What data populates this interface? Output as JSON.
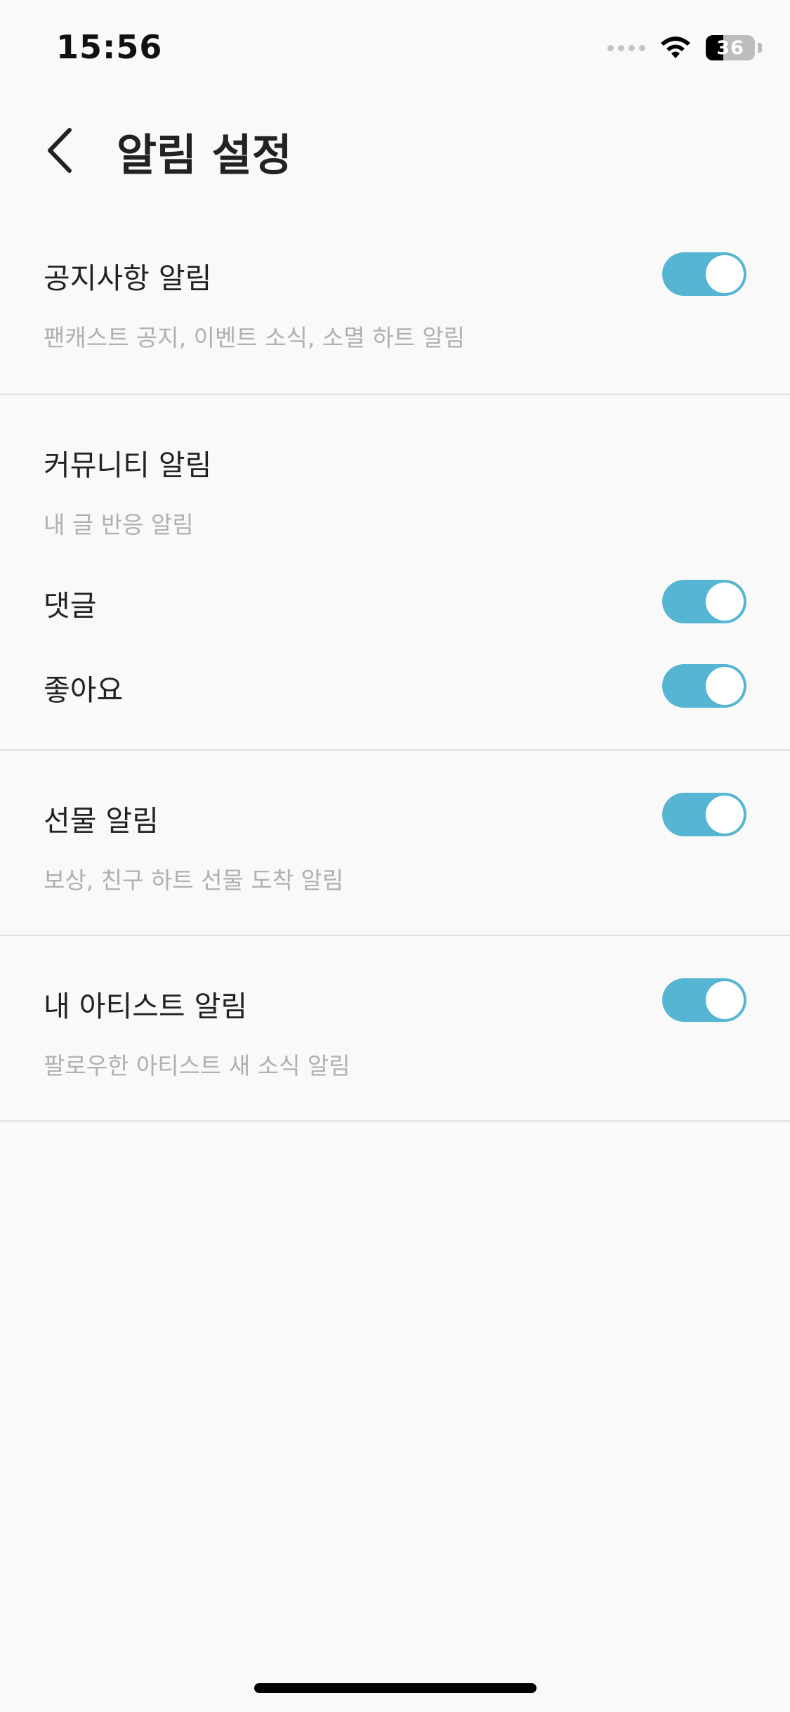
{
  "status_bar": {
    "time": "15:56",
    "battery_level": "36",
    "signal_icon": "cellular-signal-icon",
    "wifi_icon": "wifi-icon",
    "battery_icon": "battery-icon"
  },
  "header": {
    "title": "알림 설정",
    "back_icon": "chevron-left-icon"
  },
  "sections": {
    "notice": {
      "title": "공지사항 알림",
      "description": "팬캐스트 공지, 이벤트 소식, 소멸 하트 알림",
      "enabled": true
    },
    "community": {
      "title": "커뮤니티 알림",
      "description": "내 글 반응 알림",
      "items": [
        {
          "label": "댓글",
          "enabled": true
        },
        {
          "label": "좋아요",
          "enabled": true
        }
      ]
    },
    "gift": {
      "title": "선물 알림",
      "description": "보상, 친구 하트 선물 도착 알림",
      "enabled": true
    },
    "artist": {
      "title": "내 아티스트 알림",
      "description": "팔로우한 아티스트 새 소식 알림",
      "enabled": true
    }
  },
  "colors": {
    "toggle_on": "#55b5d3",
    "background": "#f9f9f9",
    "divider": "#e0e0e0",
    "description_text": "#b0b0b0"
  }
}
